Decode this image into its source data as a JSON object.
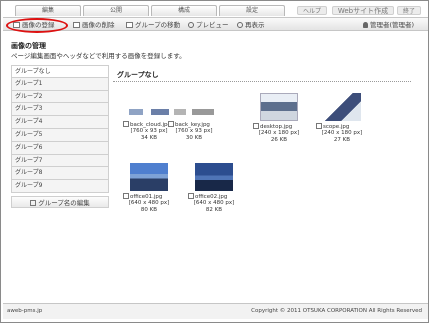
{
  "topnav": {
    "tabs": [
      "編集",
      "公開",
      "構成",
      "設定"
    ],
    "help": "ヘルプ",
    "website": "Webサイト作成",
    "logout": "終了"
  },
  "toolbar": {
    "register": "画像の登録",
    "delete": "画像の削除",
    "move_group": "グループの移動",
    "preview": "プレビュー",
    "refresh": "再表示",
    "user": "管理者(管理者)"
  },
  "page": {
    "title": "画像の管理",
    "description": "ページ編集画面やヘッダなどで利用する画像を登録します。"
  },
  "sidebar": {
    "groups": [
      "グループなし",
      "グループ1",
      "グループ2",
      "グループ3",
      "グループ4",
      "グループ5",
      "グループ6",
      "グループ7",
      "グループ8",
      "グループ9"
    ],
    "edit_button": "グループ名の編集"
  },
  "main": {
    "group_title": "グループなし",
    "images": [
      {
        "name": "back_cloud.jpg",
        "dims": "[760 x 93 px]",
        "size": "34 KB"
      },
      {
        "name": "back_key.jpg",
        "dims": "[760 x 93 px]",
        "size": "30 KB"
      },
      {
        "name": "desktop.jpg",
        "dims": "[240 x 180 px]",
        "size": "26 KB"
      },
      {
        "name": "scope.jpg",
        "dims": "[240 x 180 px]",
        "size": "27 KB"
      },
      {
        "name": "office01.jpg",
        "dims": "[640 x 480 px]",
        "size": "80 KB"
      },
      {
        "name": "office02.jpg",
        "dims": "[640 x 480 px]",
        "size": "82 KB"
      }
    ]
  },
  "footer": {
    "left": "aweb-pms.jp",
    "right": "Copyright © 2011 OTSUKA CORPORATION All Rights Reserved"
  },
  "colors": {
    "highlight": "#dd1111"
  }
}
